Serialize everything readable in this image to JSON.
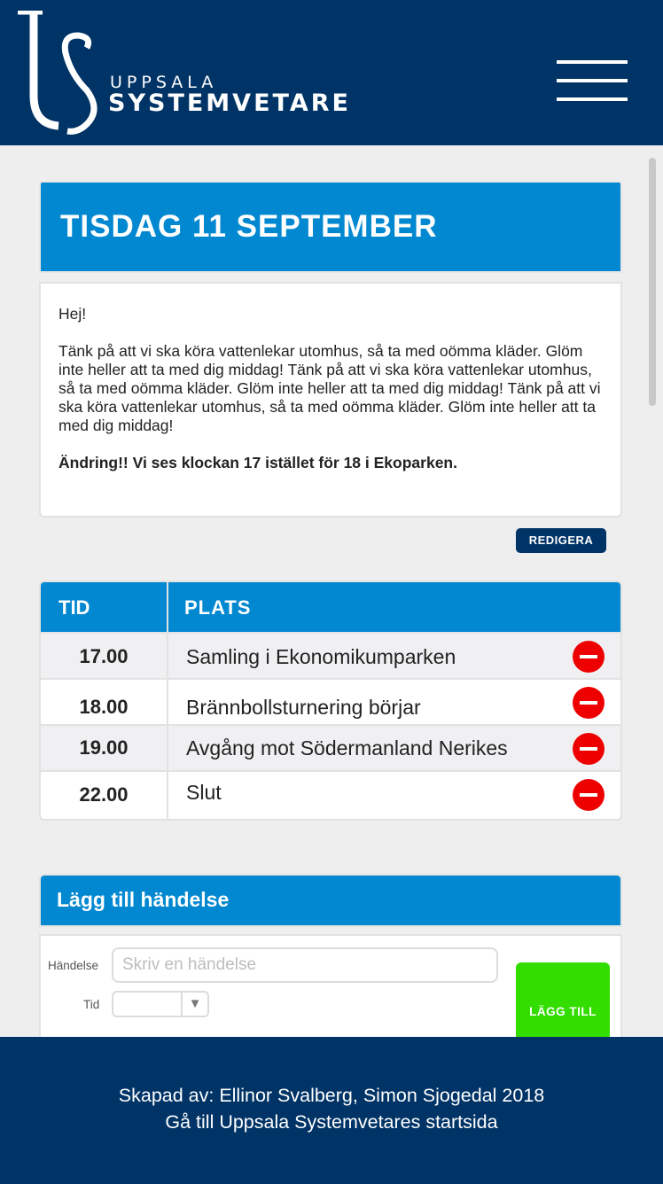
{
  "header": {
    "logo_small": "UPPSALA",
    "logo_big": "SYSTEMVETARE",
    "menu_icon": "hamburger-icon"
  },
  "day": {
    "title": "TISDAG 11 SEPTEMBER",
    "greeting": "Hej!",
    "body": "Tänk på att vi ska köra vattenlekar utomhus, så ta med oömma kläder. Glöm inte heller att ta med dig middag! Tänk på att vi ska köra vattenlekar utomhus, så ta med oömma kläder. Glöm inte heller att ta med dig middag! Tänk på att vi ska köra vattenlekar utomhus, så ta med oömma kläder. Glöm inte heller att ta med dig middag!",
    "change_notice": "Ändring!! Vi ses klockan 17 istället för 18 i Ekoparken.",
    "edit_label": "REDIGERA"
  },
  "schedule": {
    "headers": [
      "TID",
      "PLATS"
    ],
    "rows": [
      {
        "time": "17.00",
        "place": "Samling i Ekonomikumparken"
      },
      {
        "time": "18.00",
        "place": "Brännbollsturnering börjar"
      },
      {
        "time": "19.00",
        "place": "Avgång mot Södermanland Nerikes"
      },
      {
        "time": "22.00",
        "place": "Slut"
      }
    ],
    "delete_icon": "remove-circle-icon"
  },
  "add_event": {
    "title": "Lägg till händelse",
    "event_label": "Händelse",
    "event_placeholder": "Skriv en händelse",
    "time_label": "Tid",
    "time_value": "",
    "submit_label": "LÄGG TILL"
  },
  "footer": {
    "credits": "Skapad av: Ellinor Svalberg, Simon Sjogedal 2018",
    "link": "Gå till Uppsala Systemvetares startsida"
  },
  "colors": {
    "navy": "#003366",
    "blue": "#0288d1",
    "green": "#33dd00",
    "red": "#ee0000"
  }
}
